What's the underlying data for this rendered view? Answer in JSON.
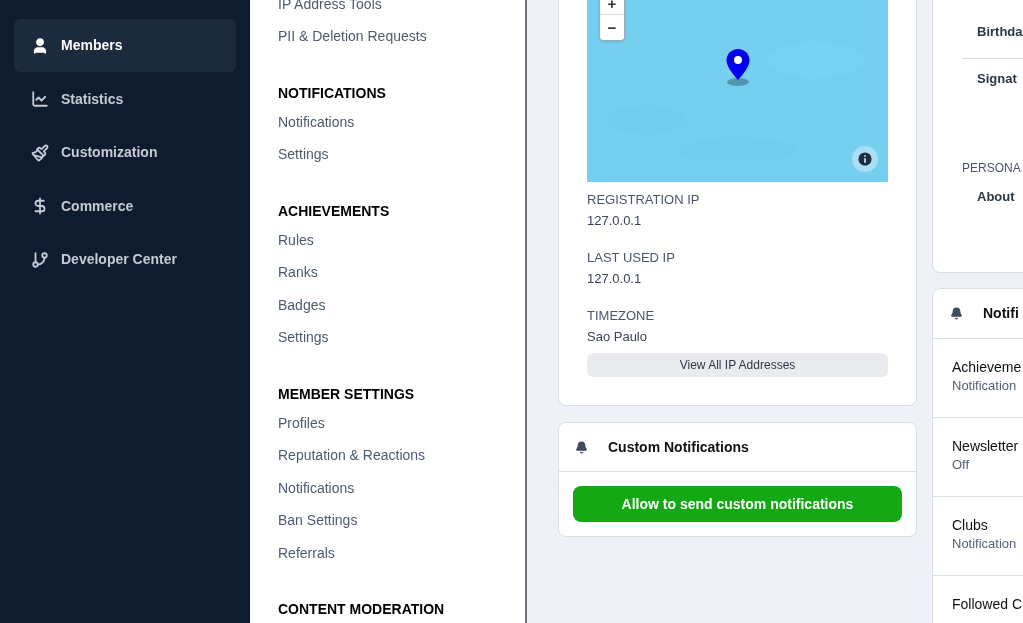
{
  "sidebar": {
    "items": [
      {
        "label": "Members",
        "selected": true
      },
      {
        "label": "Statistics",
        "selected": false
      },
      {
        "label": "Customization",
        "selected": false
      },
      {
        "label": "Commerce",
        "selected": false
      },
      {
        "label": "Developer Center",
        "selected": false
      }
    ]
  },
  "menu": {
    "sections": [
      {
        "items": [
          "IP Address Tools",
          "PII & Deletion Requests"
        ]
      },
      {
        "heading": "NOTIFICATIONS",
        "items": [
          "Notifications",
          "Settings"
        ]
      },
      {
        "heading": "ACHIEVEMENTS",
        "items": [
          "Rules",
          "Ranks",
          "Badges",
          "Settings"
        ]
      },
      {
        "heading": "MEMBER SETTINGS",
        "items": [
          "Profiles",
          "Reputation & Reactions",
          "Notifications",
          "Ban Settings",
          "Referrals"
        ]
      },
      {
        "heading": "CONTENT MODERATION"
      }
    ]
  },
  "location_card": {
    "map": {
      "kind": "picture",
      "zoom_in": "+",
      "zoom_out": "−"
    },
    "fields": [
      {
        "label": "REGISTRATION IP",
        "value": "127.0.0.1"
      },
      {
        "label": "LAST USED IP",
        "value": "127.0.0.1"
      },
      {
        "label": "TIMEZONE",
        "value": "Sao Paulo"
      }
    ],
    "button": "View All IP Addresses"
  },
  "custom_notifications": {
    "title": "Custom Notifications",
    "button": "Allow to send custom notifications"
  },
  "profile_card": {
    "rows": [
      {
        "kind": "field",
        "label": "Birthda"
      },
      {
        "kind": "field",
        "label": "Signat"
      },
      {
        "kind": "section",
        "label": "PERSONA"
      },
      {
        "kind": "field",
        "label": "About"
      }
    ]
  },
  "notification_card": {
    "title": "Notifi",
    "items": [
      {
        "name": "Achieveme",
        "value": "Notification"
      },
      {
        "name": "Newsletter",
        "value": "Off"
      },
      {
        "name": "Clubs",
        "value": "Notification"
      },
      {
        "name": "Followed C"
      }
    ]
  }
}
